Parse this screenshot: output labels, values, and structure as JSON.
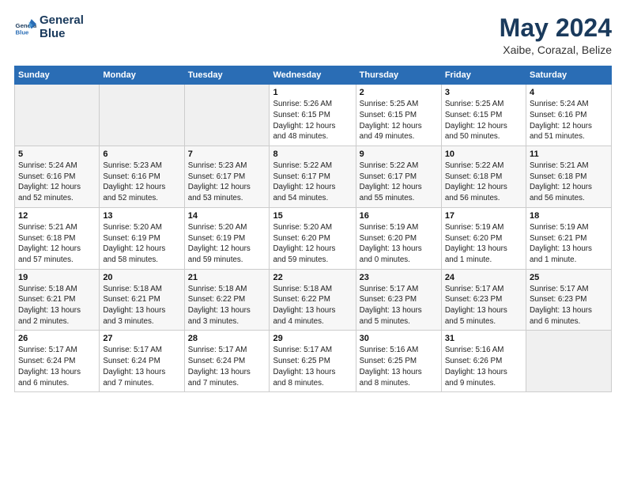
{
  "logo": {
    "line1": "General",
    "line2": "Blue"
  },
  "title": "May 2024",
  "location": "Xaibe, Corazal, Belize",
  "days_of_week": [
    "Sunday",
    "Monday",
    "Tuesday",
    "Wednesday",
    "Thursday",
    "Friday",
    "Saturday"
  ],
  "weeks": [
    [
      {
        "day": "",
        "info": ""
      },
      {
        "day": "",
        "info": ""
      },
      {
        "day": "",
        "info": ""
      },
      {
        "day": "1",
        "info": "Sunrise: 5:26 AM\nSunset: 6:15 PM\nDaylight: 12 hours\nand 48 minutes."
      },
      {
        "day": "2",
        "info": "Sunrise: 5:25 AM\nSunset: 6:15 PM\nDaylight: 12 hours\nand 49 minutes."
      },
      {
        "day": "3",
        "info": "Sunrise: 5:25 AM\nSunset: 6:15 PM\nDaylight: 12 hours\nand 50 minutes."
      },
      {
        "day": "4",
        "info": "Sunrise: 5:24 AM\nSunset: 6:16 PM\nDaylight: 12 hours\nand 51 minutes."
      }
    ],
    [
      {
        "day": "5",
        "info": "Sunrise: 5:24 AM\nSunset: 6:16 PM\nDaylight: 12 hours\nand 52 minutes."
      },
      {
        "day": "6",
        "info": "Sunrise: 5:23 AM\nSunset: 6:16 PM\nDaylight: 12 hours\nand 52 minutes."
      },
      {
        "day": "7",
        "info": "Sunrise: 5:23 AM\nSunset: 6:17 PM\nDaylight: 12 hours\nand 53 minutes."
      },
      {
        "day": "8",
        "info": "Sunrise: 5:22 AM\nSunset: 6:17 PM\nDaylight: 12 hours\nand 54 minutes."
      },
      {
        "day": "9",
        "info": "Sunrise: 5:22 AM\nSunset: 6:17 PM\nDaylight: 12 hours\nand 55 minutes."
      },
      {
        "day": "10",
        "info": "Sunrise: 5:22 AM\nSunset: 6:18 PM\nDaylight: 12 hours\nand 56 minutes."
      },
      {
        "day": "11",
        "info": "Sunrise: 5:21 AM\nSunset: 6:18 PM\nDaylight: 12 hours\nand 56 minutes."
      }
    ],
    [
      {
        "day": "12",
        "info": "Sunrise: 5:21 AM\nSunset: 6:18 PM\nDaylight: 12 hours\nand 57 minutes."
      },
      {
        "day": "13",
        "info": "Sunrise: 5:20 AM\nSunset: 6:19 PM\nDaylight: 12 hours\nand 58 minutes."
      },
      {
        "day": "14",
        "info": "Sunrise: 5:20 AM\nSunset: 6:19 PM\nDaylight: 12 hours\nand 59 minutes."
      },
      {
        "day": "15",
        "info": "Sunrise: 5:20 AM\nSunset: 6:20 PM\nDaylight: 12 hours\nand 59 minutes."
      },
      {
        "day": "16",
        "info": "Sunrise: 5:19 AM\nSunset: 6:20 PM\nDaylight: 13 hours\nand 0 minutes."
      },
      {
        "day": "17",
        "info": "Sunrise: 5:19 AM\nSunset: 6:20 PM\nDaylight: 13 hours\nand 1 minute."
      },
      {
        "day": "18",
        "info": "Sunrise: 5:19 AM\nSunset: 6:21 PM\nDaylight: 13 hours\nand 1 minute."
      }
    ],
    [
      {
        "day": "19",
        "info": "Sunrise: 5:18 AM\nSunset: 6:21 PM\nDaylight: 13 hours\nand 2 minutes."
      },
      {
        "day": "20",
        "info": "Sunrise: 5:18 AM\nSunset: 6:21 PM\nDaylight: 13 hours\nand 3 minutes."
      },
      {
        "day": "21",
        "info": "Sunrise: 5:18 AM\nSunset: 6:22 PM\nDaylight: 13 hours\nand 3 minutes."
      },
      {
        "day": "22",
        "info": "Sunrise: 5:18 AM\nSunset: 6:22 PM\nDaylight: 13 hours\nand 4 minutes."
      },
      {
        "day": "23",
        "info": "Sunrise: 5:17 AM\nSunset: 6:23 PM\nDaylight: 13 hours\nand 5 minutes."
      },
      {
        "day": "24",
        "info": "Sunrise: 5:17 AM\nSunset: 6:23 PM\nDaylight: 13 hours\nand 5 minutes."
      },
      {
        "day": "25",
        "info": "Sunrise: 5:17 AM\nSunset: 6:23 PM\nDaylight: 13 hours\nand 6 minutes."
      }
    ],
    [
      {
        "day": "26",
        "info": "Sunrise: 5:17 AM\nSunset: 6:24 PM\nDaylight: 13 hours\nand 6 minutes."
      },
      {
        "day": "27",
        "info": "Sunrise: 5:17 AM\nSunset: 6:24 PM\nDaylight: 13 hours\nand 7 minutes."
      },
      {
        "day": "28",
        "info": "Sunrise: 5:17 AM\nSunset: 6:24 PM\nDaylight: 13 hours\nand 7 minutes."
      },
      {
        "day": "29",
        "info": "Sunrise: 5:17 AM\nSunset: 6:25 PM\nDaylight: 13 hours\nand 8 minutes."
      },
      {
        "day": "30",
        "info": "Sunrise: 5:16 AM\nSunset: 6:25 PM\nDaylight: 13 hours\nand 8 minutes."
      },
      {
        "day": "31",
        "info": "Sunrise: 5:16 AM\nSunset: 6:26 PM\nDaylight: 13 hours\nand 9 minutes."
      },
      {
        "day": "",
        "info": ""
      }
    ]
  ]
}
